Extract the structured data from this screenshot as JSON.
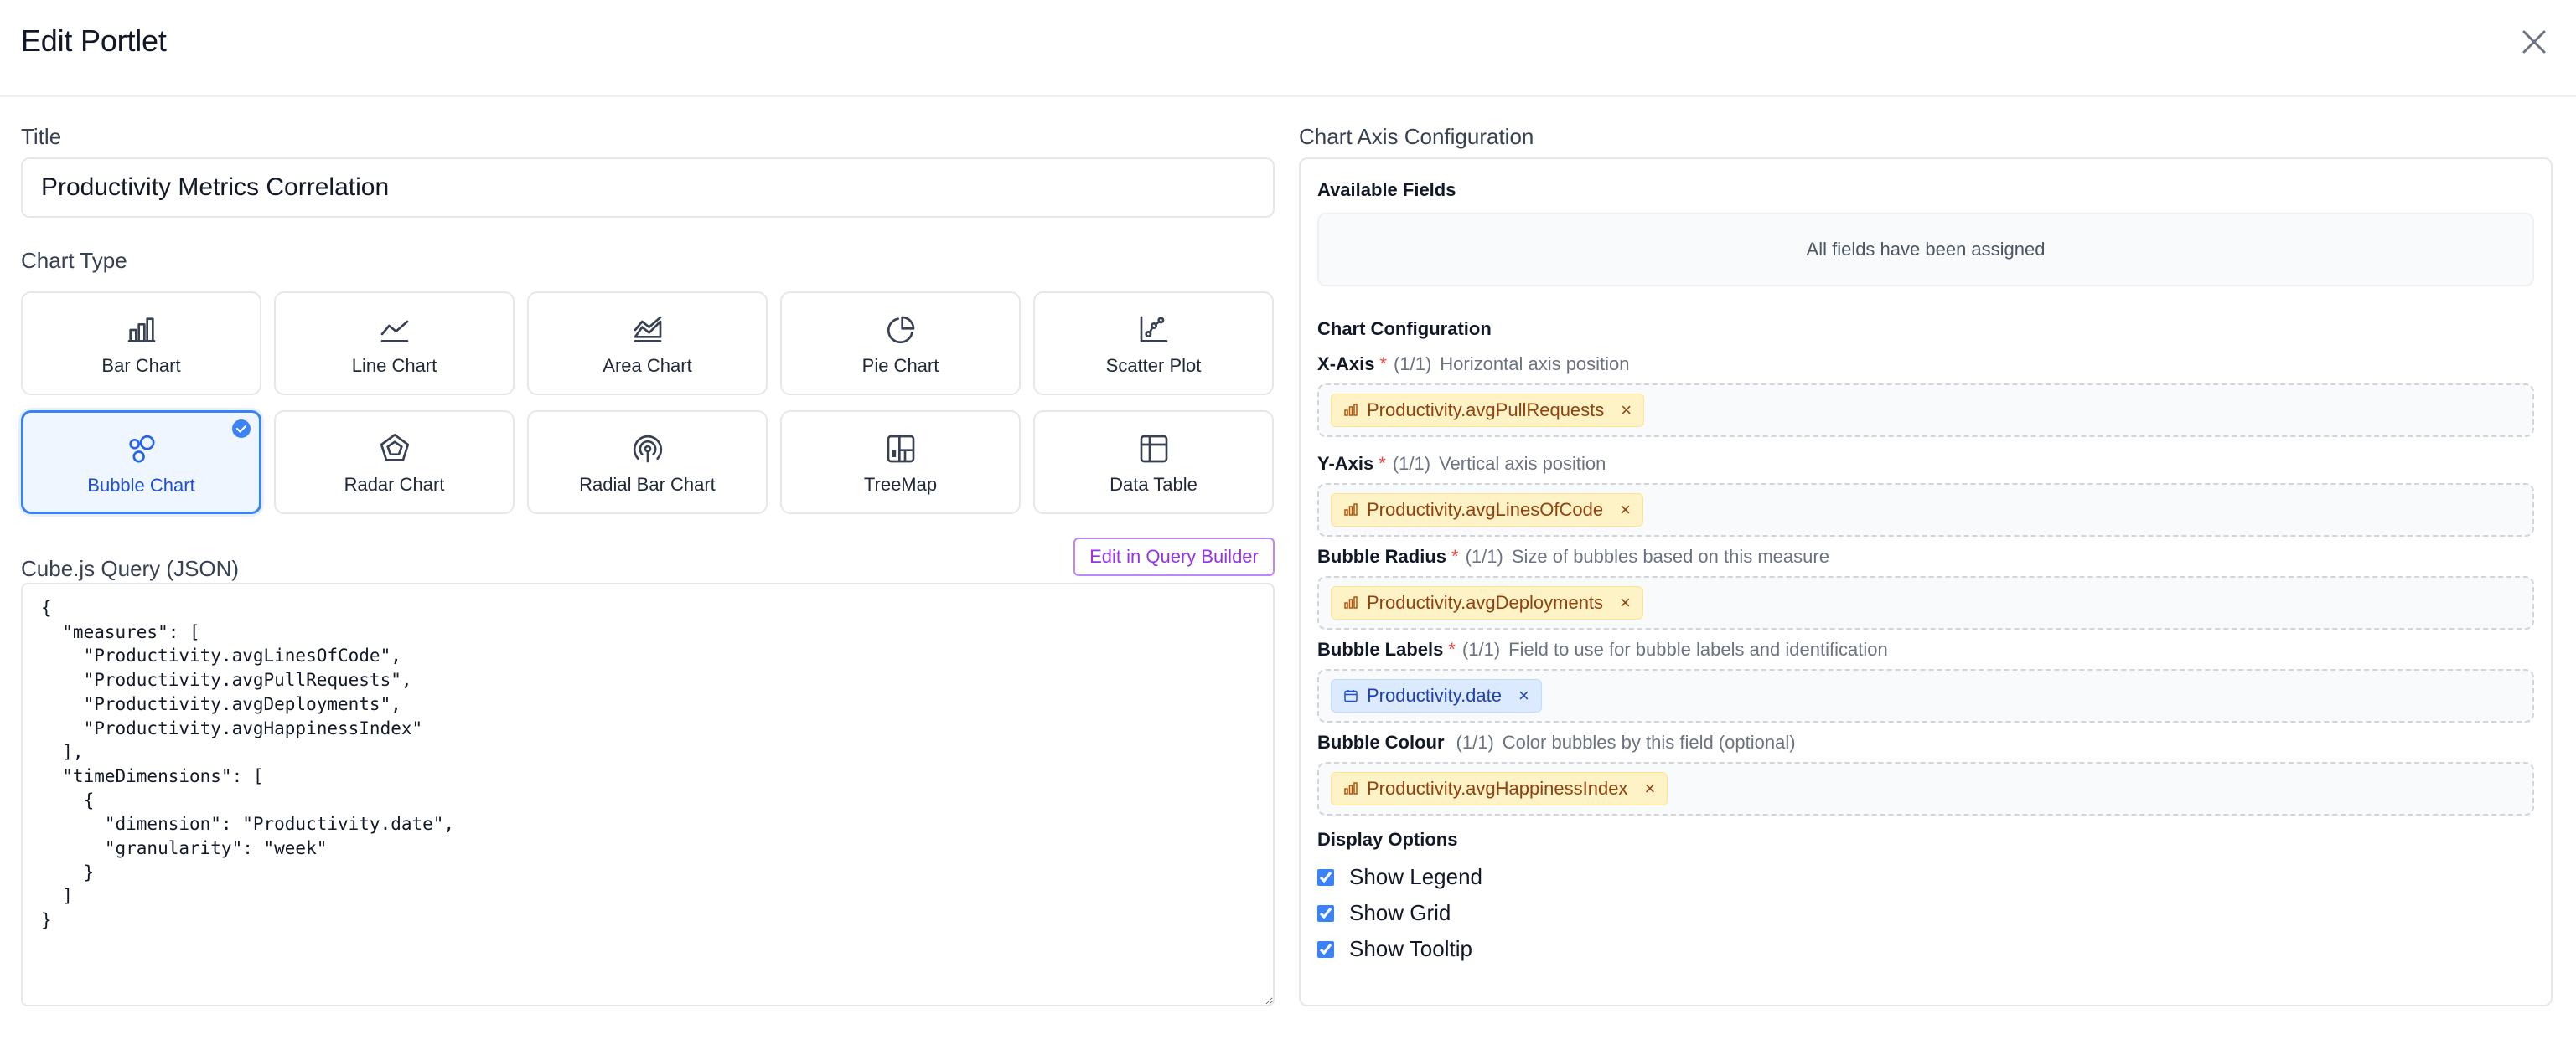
{
  "dialog": {
    "title": "Edit Portlet"
  },
  "title_field": {
    "label": "Title",
    "value": "Productivity Metrics Correlation"
  },
  "chart_type": {
    "label": "Chart Type",
    "options": [
      {
        "label": "Bar Chart",
        "icon": "bar-chart-icon",
        "selected": false
      },
      {
        "label": "Line Chart",
        "icon": "line-chart-icon",
        "selected": false
      },
      {
        "label": "Area Chart",
        "icon": "area-chart-icon",
        "selected": false
      },
      {
        "label": "Pie Chart",
        "icon": "pie-chart-icon",
        "selected": false
      },
      {
        "label": "Scatter Plot",
        "icon": "scatter-plot-icon",
        "selected": false
      },
      {
        "label": "Bubble Chart",
        "icon": "bubble-chart-icon",
        "selected": true
      },
      {
        "label": "Radar Chart",
        "icon": "radar-chart-icon",
        "selected": false
      },
      {
        "label": "Radial Bar Chart",
        "icon": "radial-bar-chart-icon",
        "selected": false
      },
      {
        "label": "TreeMap",
        "icon": "treemap-icon",
        "selected": false
      },
      {
        "label": "Data Table",
        "icon": "table-icon",
        "selected": false
      }
    ]
  },
  "query": {
    "label": "Cube.js Query (JSON)",
    "builder_button": "Edit in Query Builder",
    "json": "{\n  \"measures\": [\n    \"Productivity.avgLinesOfCode\",\n    \"Productivity.avgPullRequests\",\n    \"Productivity.avgDeployments\",\n    \"Productivity.avgHappinessIndex\"\n  ],\n  \"timeDimensions\": [\n    {\n      \"dimension\": \"Productivity.date\",\n      \"granularity\": \"week\"\n    }\n  ]\n}"
  },
  "axis_config": {
    "label": "Chart Axis Configuration",
    "available_fields": {
      "heading": "Available Fields",
      "empty_text": "All fields have been assigned"
    },
    "chart_config_heading": "Chart Configuration",
    "axes": [
      {
        "name": "X-Axis",
        "required": "*",
        "count": "(1/1)",
        "description": "Horizontal axis position",
        "field": "Productivity.avgPullRequests",
        "field_type": "measure"
      },
      {
        "name": "Y-Axis",
        "required": "*",
        "count": "(1/1)",
        "description": "Vertical axis position",
        "field": "Productivity.avgLinesOfCode",
        "field_type": "measure"
      },
      {
        "name": "Bubble Radius",
        "required": "*",
        "count": "(1/1)",
        "description": "Size of bubbles based on this measure",
        "field": "Productivity.avgDeployments",
        "field_type": "measure"
      },
      {
        "name": "Bubble Labels",
        "required": "*",
        "count": "(1/1)",
        "description": "Field to use for bubble labels and identification",
        "field": "Productivity.date",
        "field_type": "dimension"
      },
      {
        "name": "Bubble Colour",
        "required": "",
        "count": "(1/1)",
        "description": "Color bubbles by this field (optional)",
        "field": "Productivity.avgHappinessIndex",
        "field_type": "measure"
      }
    ],
    "remove_glyph": "×",
    "display_options": {
      "heading": "Display Options",
      "items": [
        {
          "label": "Show Legend",
          "checked": true
        },
        {
          "label": "Show Grid",
          "checked": true
        },
        {
          "label": "Show Tooltip",
          "checked": true
        }
      ]
    }
  },
  "colors": {
    "accent": "#3b82f6",
    "measure_chip": "#fef3c7",
    "dimension_chip": "#dbeafe",
    "builder_button": "#9333ea"
  }
}
